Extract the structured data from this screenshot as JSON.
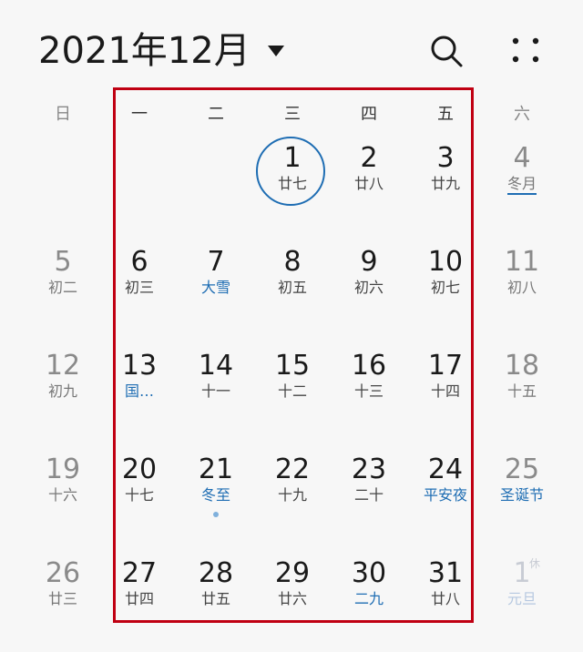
{
  "header": {
    "month_title": "2021年12月"
  },
  "weekdays": [
    "日",
    "一",
    "二",
    "三",
    "四",
    "五",
    "六"
  ],
  "weeks": [
    [
      {
        "day": "",
        "lunar": ""
      },
      {
        "day": "",
        "lunar": ""
      },
      {
        "day": "",
        "lunar": ""
      },
      {
        "day": "1",
        "lunar": "廿七",
        "today": true
      },
      {
        "day": "2",
        "lunar": "廿八"
      },
      {
        "day": "3",
        "lunar": "廿九"
      },
      {
        "day": "4",
        "lunar": "冬月",
        "underline": true
      }
    ],
    [
      {
        "day": "5",
        "lunar": "初二"
      },
      {
        "day": "6",
        "lunar": "初三"
      },
      {
        "day": "7",
        "lunar": "大雪",
        "festival": true
      },
      {
        "day": "8",
        "lunar": "初五"
      },
      {
        "day": "9",
        "lunar": "初六"
      },
      {
        "day": "10",
        "lunar": "初七"
      },
      {
        "day": "11",
        "lunar": "初八"
      }
    ],
    [
      {
        "day": "12",
        "lunar": "初九"
      },
      {
        "day": "13",
        "lunar": "国…",
        "festival": true
      },
      {
        "day": "14",
        "lunar": "十一"
      },
      {
        "day": "15",
        "lunar": "十二"
      },
      {
        "day": "16",
        "lunar": "十三"
      },
      {
        "day": "17",
        "lunar": "十四"
      },
      {
        "day": "18",
        "lunar": "十五"
      }
    ],
    [
      {
        "day": "19",
        "lunar": "十六"
      },
      {
        "day": "20",
        "lunar": "十七"
      },
      {
        "day": "21",
        "lunar": "冬至",
        "festival": true,
        "dot": true
      },
      {
        "day": "22",
        "lunar": "十九"
      },
      {
        "day": "23",
        "lunar": "二十"
      },
      {
        "day": "24",
        "lunar": "平安夜",
        "festival": true
      },
      {
        "day": "25",
        "lunar": "圣诞节",
        "festival": true
      }
    ],
    [
      {
        "day": "26",
        "lunar": "廿三"
      },
      {
        "day": "27",
        "lunar": "廿四"
      },
      {
        "day": "28",
        "lunar": "廿五"
      },
      {
        "day": "29",
        "lunar": "廿六"
      },
      {
        "day": "30",
        "lunar": "二九",
        "festival": true
      },
      {
        "day": "31",
        "lunar": "廿八"
      },
      {
        "day": "1",
        "lunar": "元旦",
        "other_month": true,
        "badge": "休"
      }
    ]
  ],
  "colors": {
    "accent": "#1e6db3",
    "highlight": "#c00012",
    "background": "#f7f7f7"
  },
  "icons": {
    "dropdown": "caret-down-icon",
    "search": "search-icon",
    "more": "more-dots-icon"
  }
}
